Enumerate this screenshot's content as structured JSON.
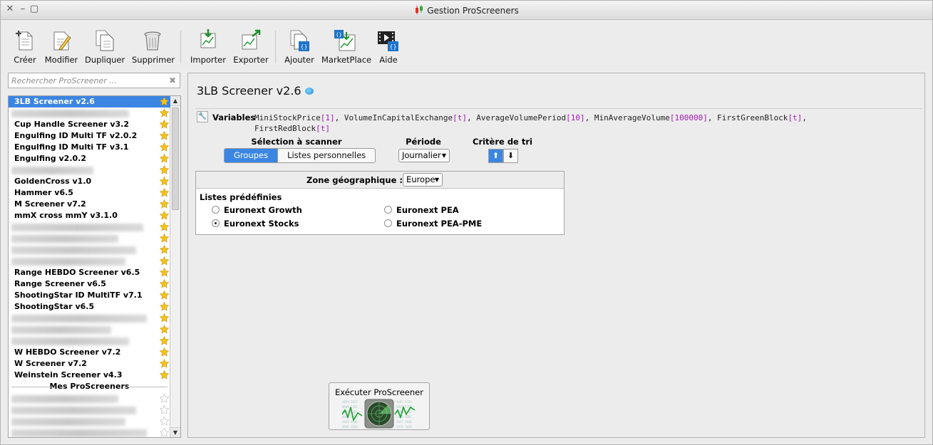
{
  "window": {
    "title": "Gestion ProScreeners"
  },
  "toolbar": {
    "creer": "Créer",
    "modifier": "Modifier",
    "dupliquer": "Dupliquer",
    "supprimer": "Supprimer",
    "importer": "Importer",
    "exporter": "Exporter",
    "ajouter": "Ajouter",
    "marketplace": "MarketPlace",
    "aide": "Aide"
  },
  "search": {
    "placeholder": "Rechercher ProScreener ..."
  },
  "list": {
    "items": [
      "3LB Screener v2.6",
      "",
      "Cup Handle Screener v3.2",
      "Engulfing ID Multi TF v2.0.2",
      "Engulfing ID Multi TF v3.1",
      "Engulfing v2.0.2",
      "",
      "GoldenCross v1.0",
      "Hammer v6.5",
      "M Screener v7.2",
      "mmX cross mmY v3.1.0",
      "",
      "",
      "",
      "",
      "Range HEBDO Screener v6.5",
      "Range Screener v6.5",
      "ShootingStar ID MultiTF v7.1",
      "ShootingStar v6.5",
      "",
      "",
      "",
      "W HEBDO Screener v7.2",
      "W Screener v7.2",
      "Weinstein Screener v4.3"
    ],
    "section_mes": "Mes ProScreeners"
  },
  "main": {
    "title": "3LB Screener v2.6",
    "variables_label": "Variables",
    "variables": {
      "v1": "MiniStockPrice",
      "p1": "[1]",
      "v2": "VolumeInCapitalExchange",
      "p2": "[t]",
      "v3": "AverageVolumePeriod",
      "p3": "[10]",
      "v4": "MinAverageVolume",
      "p4": "[100000]",
      "v5": "FirstGreenBlock",
      "p5": "[t]",
      "v6": "FirstRedBlock",
      "p6": "[t]"
    },
    "selection_label": "Sélection à scanner",
    "seg_groupes": "Groupes",
    "seg_listes": "Listes personnelles",
    "periode_label": "Période",
    "periode_value": "Journalier",
    "critere_label": "Critère de tri",
    "zone_label": "Zone géographique :",
    "zone_value": "Europe",
    "listes_label": "Listes prédéfinies",
    "radios": {
      "growth": "Euronext Growth",
      "pea": "Euronext PEA",
      "stocks": "Euronext Stocks",
      "peapme": "Euronext PEA-PME"
    },
    "run_label": "Exécuter ProScreener"
  },
  "colors": {
    "accent": "#3b86e3",
    "param": "#a21ab5",
    "star": "#f5c21b"
  }
}
